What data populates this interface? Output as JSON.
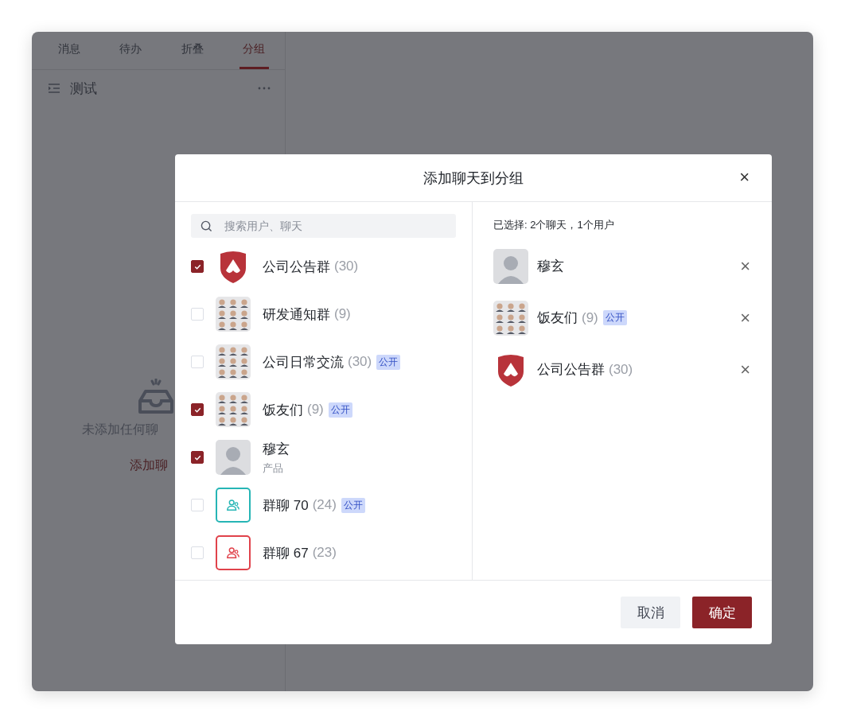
{
  "sidebar": {
    "tabs": [
      {
        "label": "消息",
        "selected": false
      },
      {
        "label": "待办",
        "selected": false
      },
      {
        "label": "折叠",
        "selected": false
      },
      {
        "label": "分组",
        "selected": true
      }
    ],
    "group": {
      "name": "测试"
    },
    "empty_state": {
      "message": "未添加任何聊",
      "action": "添加聊"
    }
  },
  "dialog": {
    "title": "添加聊天到分组",
    "close": "×",
    "search": {
      "placeholder": "搜索用户、聊天"
    },
    "items": [
      {
        "kind": "shield",
        "name": "公司公告群",
        "count": "(30)",
        "checked": true
      },
      {
        "kind": "collage",
        "name": "研发通知群",
        "count": "(9)",
        "checked": false
      },
      {
        "kind": "collage",
        "name": "公司日常交流",
        "count": "(30)",
        "tag": "公开",
        "checked": false
      },
      {
        "kind": "collage",
        "name": "饭友们",
        "count": "(9)",
        "tag": "公开",
        "checked": true
      },
      {
        "kind": "person",
        "name": "穆玄",
        "subtitle": "产品",
        "checked": true
      },
      {
        "kind": "group",
        "color": "#26b5b5",
        "name": "群聊 70",
        "count": "(24)",
        "tag": "公开",
        "checked": false
      },
      {
        "kind": "group",
        "color": "#e0424b",
        "name": "群聊 67",
        "count": "(23)",
        "checked": false
      }
    ],
    "selected_summary": "已选择: 2个聊天，1个用户",
    "selected": [
      {
        "kind": "person",
        "name": "穆玄",
        "remove": "×"
      },
      {
        "kind": "collage",
        "name": "饭友们",
        "count": "(9)",
        "tag": "公开",
        "remove": "×"
      },
      {
        "kind": "shield",
        "name": "公司公告群",
        "count": "(30)",
        "remove": "×"
      }
    ],
    "buttons": {
      "cancel": "取消",
      "confirm": "确定"
    }
  }
}
